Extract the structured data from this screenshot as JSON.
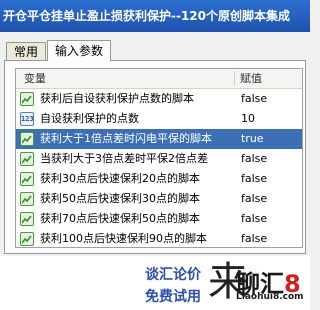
{
  "window": {
    "title": "开仓平仓挂单止盈止损获利保护--120个原创脚本集成"
  },
  "tabs": [
    {
      "label": "常用",
      "active": false
    },
    {
      "label": "输入参数",
      "active": true
    }
  ],
  "table": {
    "columns": [
      "变量",
      "赋值"
    ],
    "rows": [
      {
        "icon": "chart-icon",
        "name": "获利后自设获利保护点数的脚本",
        "value": "false",
        "selected": false
      },
      {
        "icon": "number-123-icon",
        "name": "自设获利保护的点数",
        "value": "10",
        "selected": false
      },
      {
        "icon": "chart-icon",
        "name": "获利大于1倍点差时闪电平保的脚本",
        "value": "true",
        "selected": true
      },
      {
        "icon": "chart-icon",
        "name": "当获利大于3倍点差时平保2倍点差",
        "value": "false",
        "selected": false
      },
      {
        "icon": "chart-icon",
        "name": "获利30点后快速保利20点的脚本",
        "value": "false",
        "selected": false
      },
      {
        "icon": "chart-icon",
        "name": "获利50点后快速保利30点的脚本",
        "value": "false",
        "selected": false
      },
      {
        "icon": "chart-icon",
        "name": "获利70点后快速保利50点的脚本",
        "value": "false",
        "selected": false
      },
      {
        "icon": "chart-icon",
        "name": "获利100点后快速保利90点的脚本",
        "value": "false",
        "selected": false
      }
    ]
  },
  "promo": {
    "line1": "谈汇论价",
    "line2": "免费试用",
    "mark": "来",
    "brand_a": "聊汇",
    "brand_b": "8",
    "url": "Liaohui8.com"
  },
  "colors": {
    "titlebar": "#2c6fd0",
    "selected_row": "#3d6fb5",
    "promo_text": "#2d4fb0",
    "brand_accent": "#d02020"
  }
}
